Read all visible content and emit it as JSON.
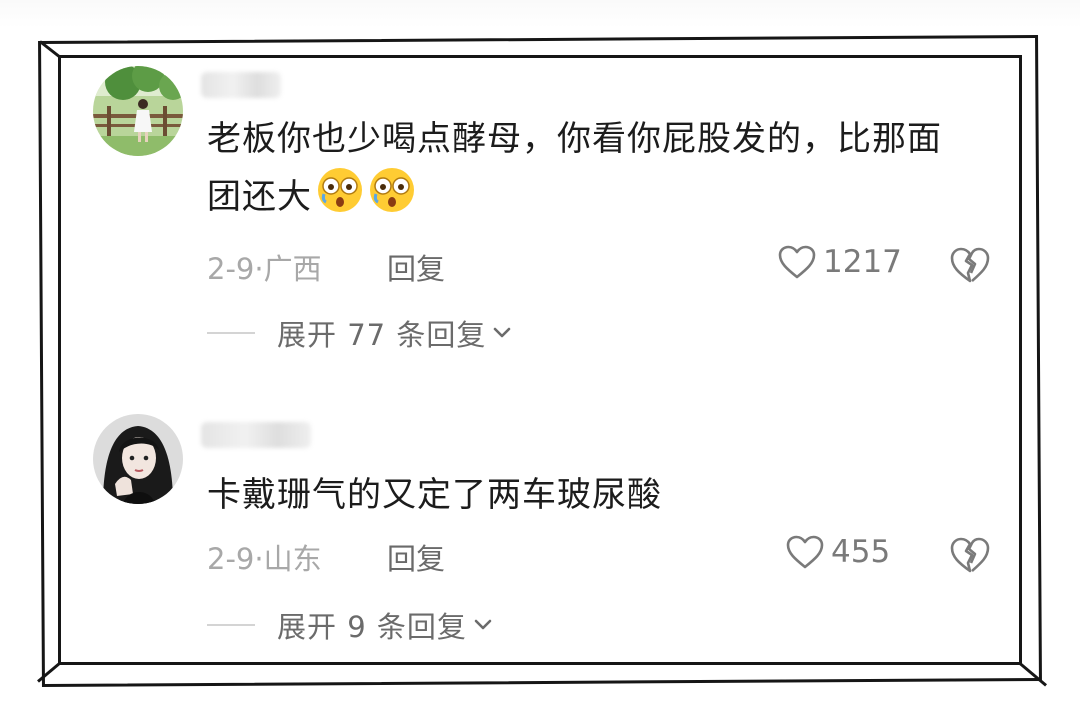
{
  "comments": [
    {
      "text_line1": "老板你也少喝点酵母，你看你屁股发的，比那面",
      "text_line2": "团还大",
      "emoji_icon": "astonished-face-icon",
      "date": "2-9",
      "separator": "·",
      "location": "广西",
      "reply_label": "回复",
      "like_count": "1217",
      "expand_label": "展开 77 条回复"
    },
    {
      "text_line1": "卡戴珊气的又定了两车玻尿酸",
      "date": "2-9",
      "separator": "·",
      "location": "山东",
      "reply_label": "回复",
      "like_count": "455",
      "expand_label": "展开 9 条回复"
    }
  ],
  "colors": {
    "text": "#1c1c1c",
    "meta": "#a8a8a8",
    "action": "#6b6b6b",
    "frame": "#161616"
  }
}
